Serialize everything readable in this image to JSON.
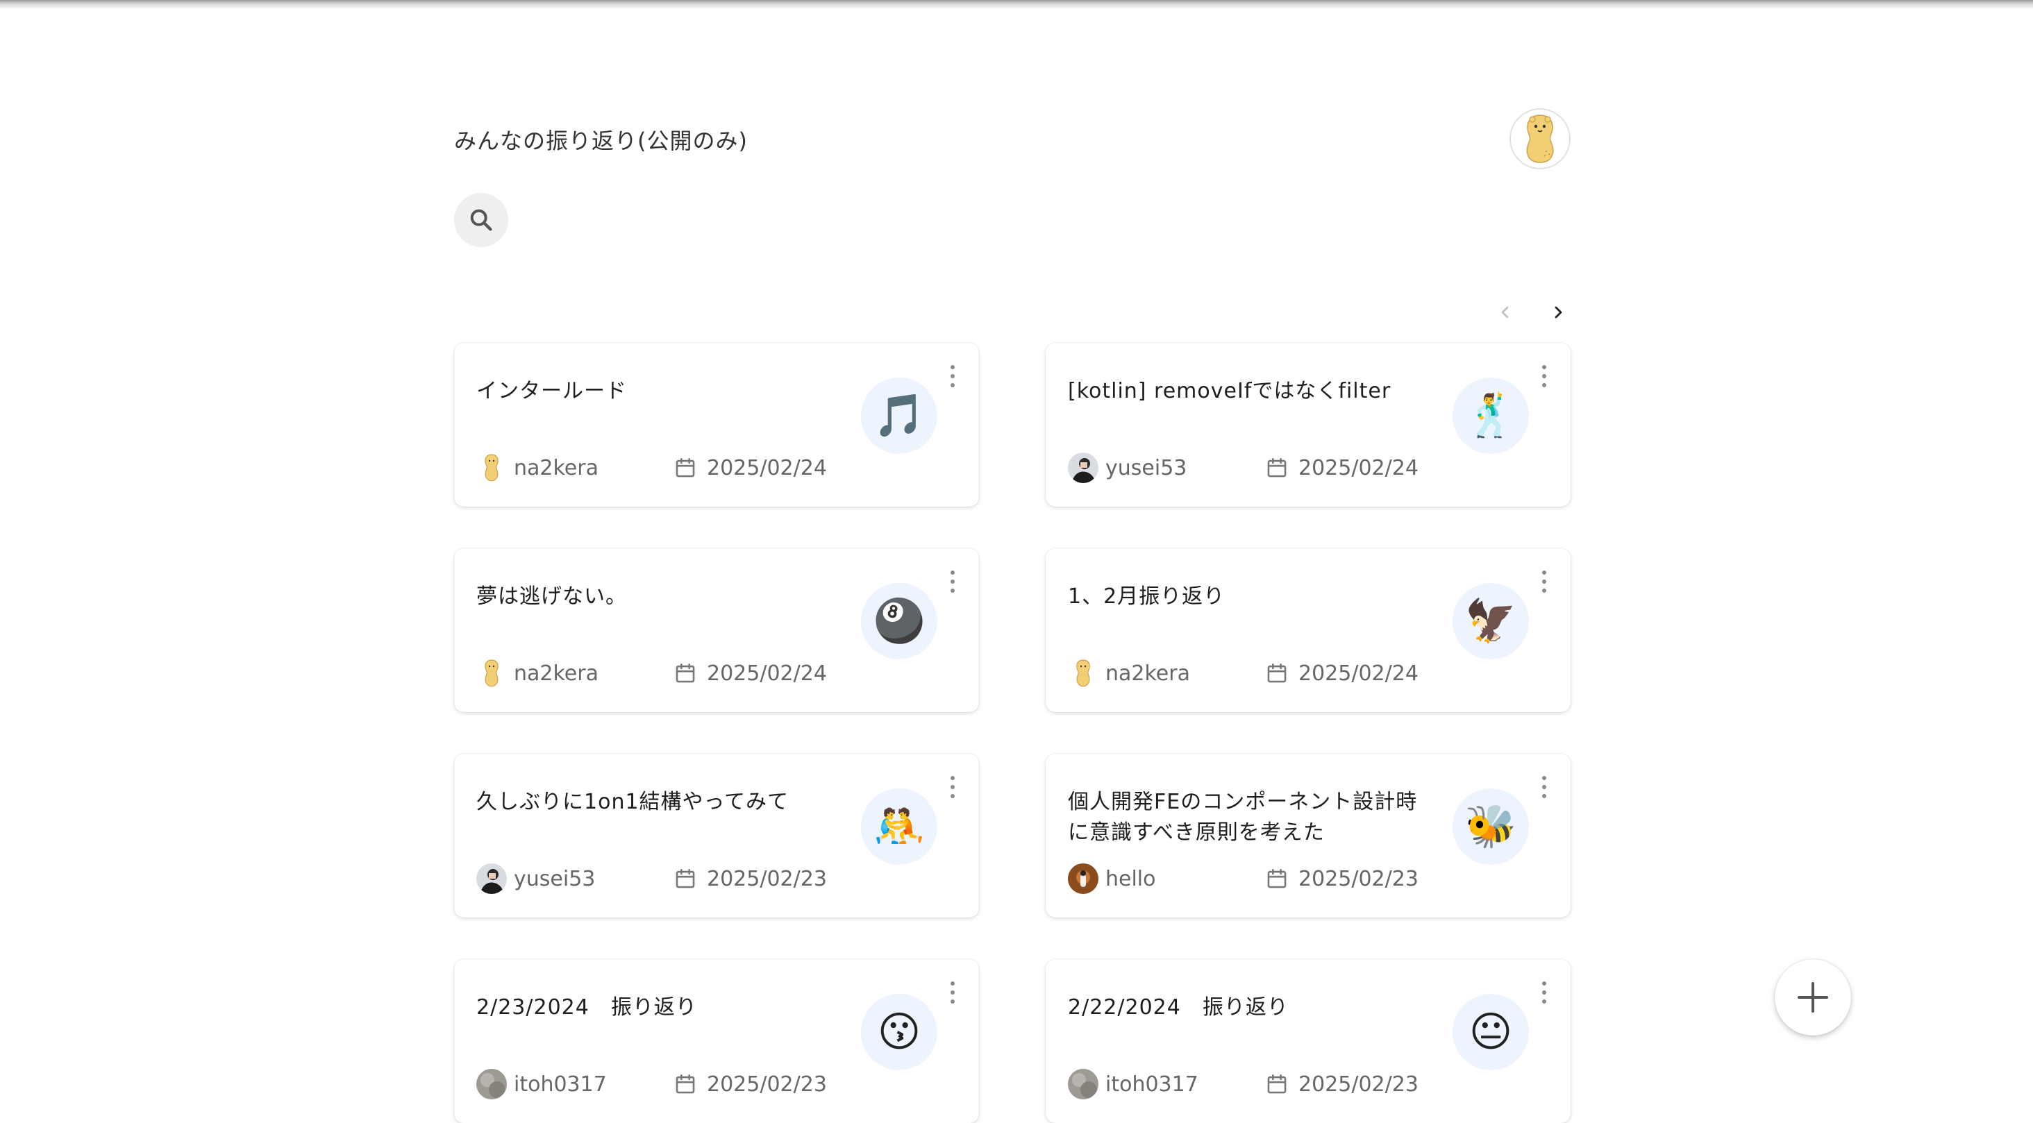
{
  "header": {
    "title": "みんなの振り返り(公開のみ)",
    "user_avatar": "peanut-mascot-avatar"
  },
  "search": {
    "icon": "search-icon"
  },
  "pagination": {
    "prev_icon": "chevron-left-icon",
    "next_icon": "chevron-right-icon",
    "prev_disabled": true
  },
  "posts": [
    {
      "title": "インタールード",
      "emoji": "🎵",
      "author": "na2kera",
      "avatar": "peanut",
      "date": "2025/02/24"
    },
    {
      "title": "[kotlin] removeIfではなくfilter",
      "emoji": "🕺",
      "author": "yusei53",
      "avatar": "photo-dark",
      "date": "2025/02/24"
    },
    {
      "title": "夢は逃げない。",
      "emoji": "🎱",
      "author": "na2kera",
      "avatar": "peanut",
      "date": "2025/02/24"
    },
    {
      "title": "1、2月振り返り",
      "emoji": "🦅",
      "author": "na2kera",
      "avatar": "peanut",
      "date": "2025/02/24"
    },
    {
      "title": "久しぶりに1on1結構やってみて",
      "emoji": "🤼",
      "author": "yusei53",
      "avatar": "photo-dark",
      "date": "2025/02/23"
    },
    {
      "title": "個人開発FEのコンポーネント設計時に意識すべき原則を考えた",
      "emoji": "🐝",
      "author": "hello",
      "avatar": "photo-brown",
      "date": "2025/02/23"
    },
    {
      "title": "2/23/2024　振り返り",
      "emoji": "😗",
      "author": "itoh0317",
      "avatar": "photo-gray",
      "date": "2025/02/23"
    },
    {
      "title": "2/22/2024　振り返り",
      "emoji": "😐",
      "author": "itoh0317",
      "avatar": "photo-gray",
      "date": "2025/02/23"
    }
  ],
  "fab": {
    "icon": "plus-icon"
  },
  "colors": {
    "emoji_bg": "#edf4fd",
    "muted_text": "#666666",
    "peanut": "#f2cf74"
  }
}
